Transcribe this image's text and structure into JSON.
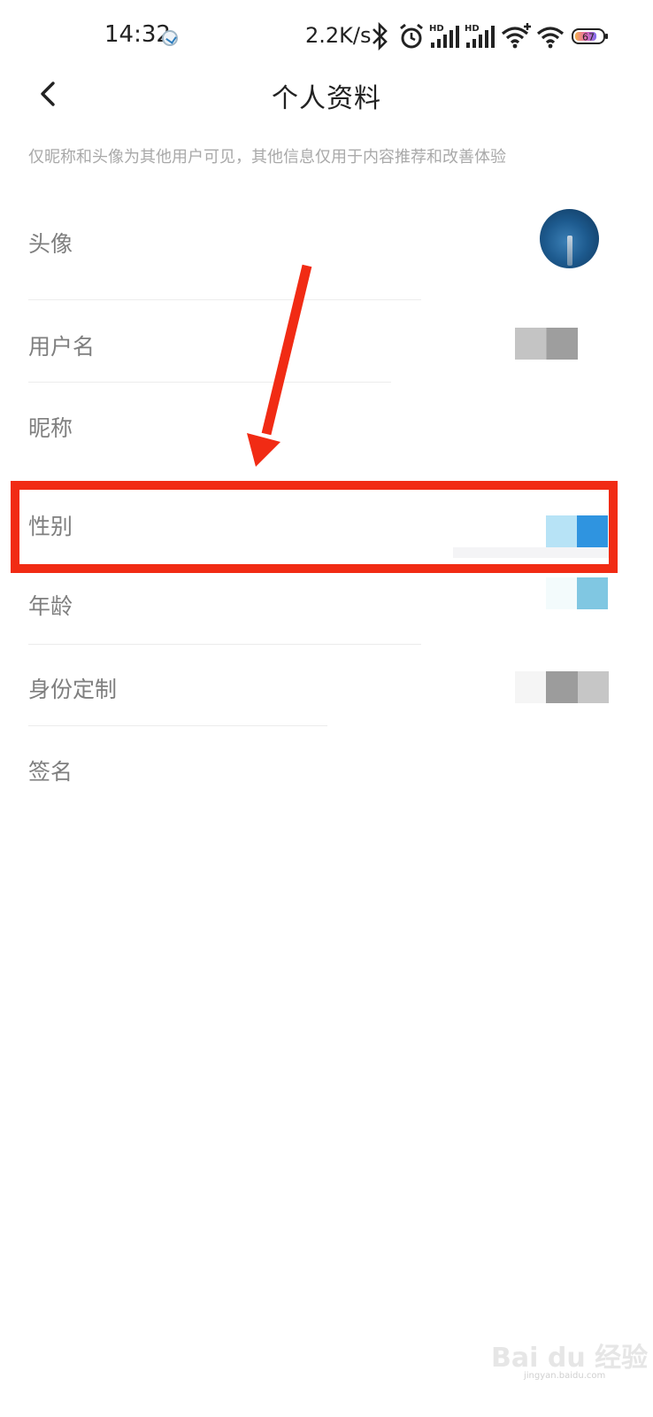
{
  "status_bar": {
    "time": "14:32",
    "net_speed": "2.2K/s",
    "battery": "67",
    "icons": [
      "bluetooth-icon",
      "alarm-icon",
      "signal-hd-icon",
      "signal-hd-icon",
      "wifi-plus-icon",
      "wifi-icon",
      "battery-icon"
    ]
  },
  "header": {
    "title": "个人资料",
    "back_icon": "chevron-left-icon"
  },
  "hint": "仅昵称和头像为其他用户可见，其他信息仅用于内容推荐和改善体验",
  "rows": [
    {
      "label": "头像"
    },
    {
      "label": "用户名"
    },
    {
      "label": "昵称"
    },
    {
      "label": "性别"
    },
    {
      "label": "年龄"
    },
    {
      "label": "身份定制"
    },
    {
      "label": "签名"
    }
  ],
  "watermark": {
    "text": "Bai du 经验",
    "sub": "jingyan.baidu.com"
  },
  "colors": {
    "annotation": "#f12b14",
    "label": "#7f7f7f",
    "hint": "#a9a9a9"
  }
}
